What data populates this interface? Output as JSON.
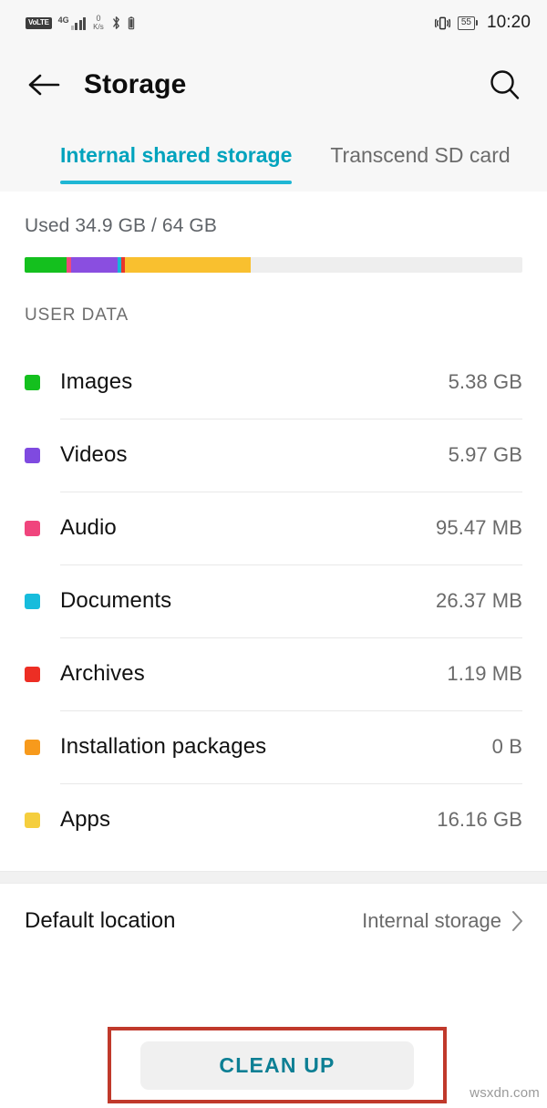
{
  "status_bar": {
    "volte_label": "VoLTE",
    "network_gen": "4G",
    "data_rate_value": "0",
    "data_rate_unit": "K/s",
    "bluetooth_icon": "bluetooth-icon",
    "vibrate_icon": "vibrate-icon",
    "battery_level": "55",
    "time": "10:20"
  },
  "app_bar": {
    "back_icon": "back-arrow-icon",
    "title": "Storage",
    "search_icon": "search-icon"
  },
  "tabs": [
    {
      "label": "Internal shared storage",
      "active": true
    },
    {
      "label": "Transcend SD card",
      "active": false
    }
  ],
  "usage": {
    "summary": "Used 34.9 GB / 64 GB",
    "used": "34.9 GB",
    "total": "64 GB",
    "track_color": "#eeeeee",
    "segments": [
      {
        "name": "Images",
        "color": "#14c01e",
        "percent": 8.4
      },
      {
        "name": "Audio",
        "color": "#ef4a7b",
        "percent": 0.9
      },
      {
        "name": "Videos",
        "color": "#8a4ee0",
        "percent": 9.3
      },
      {
        "name": "Documents",
        "color": "#16b8d8",
        "percent": 0.8
      },
      {
        "name": "Archives",
        "color": "#e8372c",
        "percent": 0.8
      },
      {
        "name": "Apps",
        "color": "#f9c02f",
        "percent": 25.3
      }
    ]
  },
  "user_data": {
    "section_title": "USER DATA",
    "items": [
      {
        "label": "Images",
        "value": "5.38 GB",
        "color": "#14c01e"
      },
      {
        "label": "Videos",
        "value": "5.97 GB",
        "color": "#7f4ae0"
      },
      {
        "label": "Audio",
        "value": "95.47 MB",
        "color": "#f0457d"
      },
      {
        "label": "Documents",
        "value": "26.37 MB",
        "color": "#17bcdc"
      },
      {
        "label": "Archives",
        "value": "1.19 MB",
        "color": "#ed2e24"
      },
      {
        "label": "Installation packages",
        "value": "0 B",
        "color": "#f79a1c"
      },
      {
        "label": "Apps",
        "value": "16.16 GB",
        "color": "#f5ce3e"
      }
    ]
  },
  "preferences": {
    "default_location_label": "Default location",
    "default_location_value": "Internal storage",
    "chevron_icon": "chevron-right-icon"
  },
  "cleanup": {
    "button_label": "CLEAN UP",
    "highlight_color": "#c0392b",
    "text_color": "#0d7f94"
  },
  "watermark": "wsxdn.com"
}
